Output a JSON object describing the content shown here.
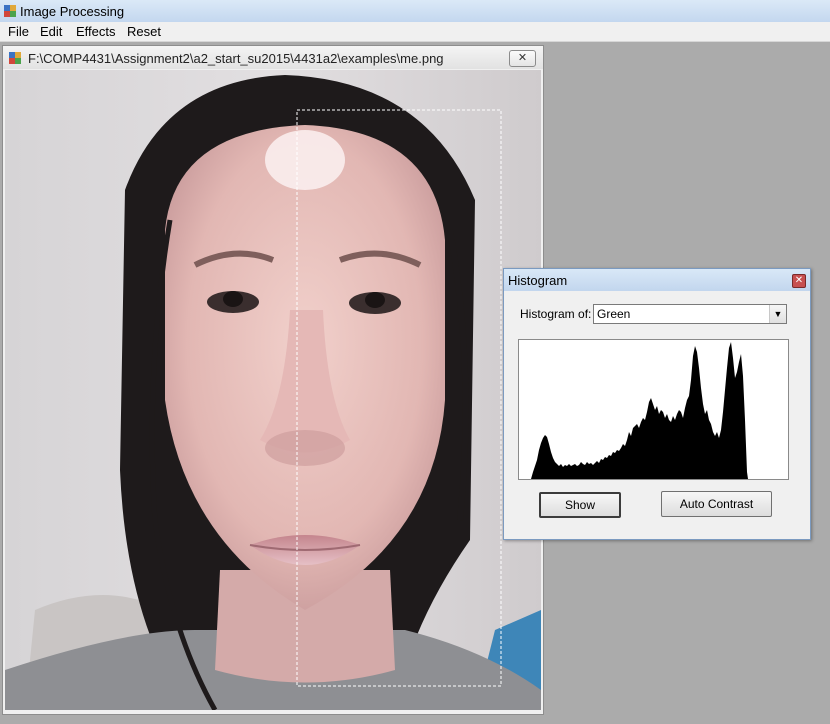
{
  "app": {
    "title": "Image Processing"
  },
  "menu": [
    "File",
    "Edit",
    "Effects",
    "Reset"
  ],
  "image_window": {
    "title": "F:\\COMP4431\\Assignment2\\a2_start_su2015\\4431a2\\examples\\me.png",
    "close_label": "✕"
  },
  "histogram": {
    "title": "Histogram",
    "label": "Histogram of:",
    "channel": "Green",
    "show_label": "Show",
    "auto_contrast_label": "Auto Contrast",
    "close_label": "✕"
  },
  "icons": {
    "app": "app-icon",
    "document": "document-icon",
    "close": "close-icon",
    "dropdown": "chevron-down-icon"
  },
  "colors": {
    "title_bar": "#c3d7ef",
    "workspace": "#ababab",
    "histogram_fill": "#000000"
  }
}
